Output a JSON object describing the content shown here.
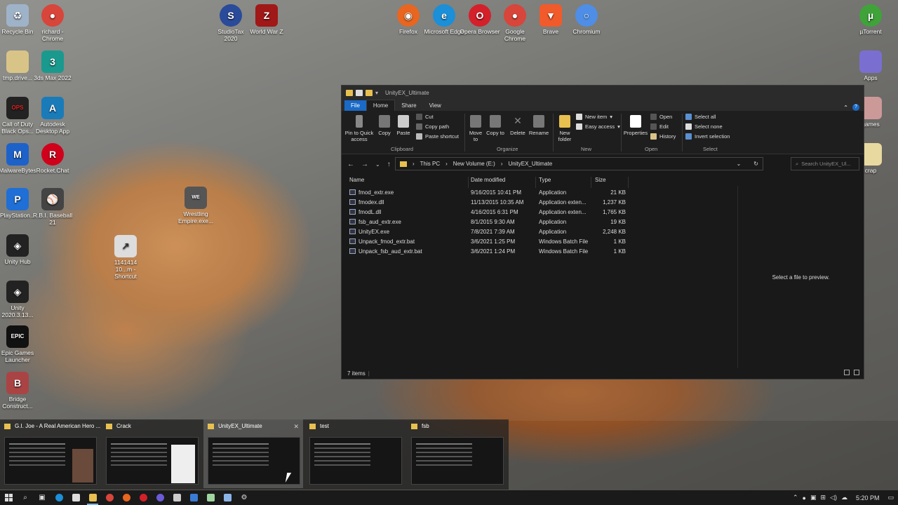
{
  "desktop": {
    "icons": [
      {
        "label": "Recycle Bin",
        "icon": "recycle-bin-icon",
        "color": "#9fb3c8"
      },
      {
        "label": "richard - Chrome",
        "icon": "chrome-icon",
        "color": "#d8453a"
      },
      {
        "label": "StudioTax 2020",
        "icon": "studiotax-icon",
        "color": "#2a4a9a"
      },
      {
        "label": "World War Z",
        "icon": "worldwarz-icon",
        "color": "#a01818"
      },
      {
        "label": "Firefox",
        "icon": "firefox-icon",
        "color": "#e8661f"
      },
      {
        "label": "Microsoft Edge",
        "icon": "edge-icon",
        "color": "#1b8fd8"
      },
      {
        "label": "Opera Browser",
        "icon": "opera-icon",
        "color": "#d4202a"
      },
      {
        "label": "Google Chrome",
        "icon": "chrome-icon",
        "color": "#d8453a"
      },
      {
        "label": "Brave",
        "icon": "brave-icon",
        "color": "#f15a2a"
      },
      {
        "label": "Chromium",
        "icon": "chromium-icon",
        "color": "#4e8ee6"
      },
      {
        "label": "µTorrent",
        "icon": "utorrent-icon",
        "color": "#3fa33a"
      },
      {
        "label": "tmp.drive...",
        "icon": "folder-icon",
        "color": "#d9c488"
      },
      {
        "label": "3ds Max 2022",
        "icon": "3dsmax-icon",
        "color": "#1a9a8e"
      },
      {
        "label": "Apps",
        "icon": "apps-folder-icon",
        "color": "#7a6fd0"
      },
      {
        "label": "Call of Duty Black Ops...",
        "icon": "cod-icon",
        "color": "#222"
      },
      {
        "label": "Autodesk Desktop App",
        "icon": "autodesk-icon",
        "color": "#1a7bb9"
      },
      {
        "label": "games",
        "icon": "games-folder-icon",
        "color": "#c99"
      },
      {
        "label": "MalwareBytes",
        "icon": "malwarebytes-icon",
        "color": "#1d62c9"
      },
      {
        "label": "Rocket.Chat",
        "icon": "rocketchat-icon",
        "color": "#d0021b"
      },
      {
        "label": "crap",
        "icon": "crap-folder-icon",
        "color": "#e8d9a0"
      },
      {
        "label": "Wrestling Empire.exe...",
        "icon": "wrestling-icon",
        "color": "#555"
      },
      {
        "label": "PlayStation...",
        "icon": "playstation-icon",
        "color": "#1f6fd6"
      },
      {
        "label": "R.B.I. Baseball 21",
        "icon": "rbi-icon",
        "color": "#444"
      },
      {
        "label": "1141414 10...m - Shortcut",
        "icon": "shortcut-icon",
        "color": "#ddd"
      },
      {
        "label": "Unity Hub",
        "icon": "unity-hub-icon",
        "color": "#222"
      },
      {
        "label": "Unity 2020.3.13...",
        "icon": "unity-icon",
        "color": "#222"
      },
      {
        "label": "Epic Games Launcher",
        "icon": "epic-icon",
        "color": "#111"
      },
      {
        "label": "Bridge Construct...",
        "icon": "bridge-icon",
        "color": "#a44"
      }
    ]
  },
  "explorer": {
    "title": "UnityEX_Ultimate",
    "tabs": [
      "File",
      "Home",
      "Share",
      "View"
    ],
    "ribbon": {
      "pin_quick_access": "Pin to Quick access",
      "copy": "Copy",
      "paste": "Paste",
      "cut": "Cut",
      "copy_path": "Copy path",
      "paste_shortcut": "Paste shortcut",
      "move_to": "Move to",
      "copy_to": "Copy to",
      "delete": "Delete",
      "rename": "Rename",
      "new_folder": "New folder",
      "new_item": "New item",
      "easy_access": "Easy access",
      "properties": "Properties",
      "open": "Open",
      "edit": "Edit",
      "history": "History",
      "select_all": "Select all",
      "select_none": "Select none",
      "invert_selection": "Invert selection",
      "groups": {
        "clipboard": "Clipboard",
        "organize": "Organize",
        "new": "New",
        "open": "Open",
        "select": "Select"
      }
    },
    "breadcrumb": [
      "This PC",
      "New Volume (E:)",
      "UnityEX_Ultimate"
    ],
    "search_placeholder": "Search UnityEX_Ul...",
    "columns": {
      "name": "Name",
      "date": "Date modified",
      "type": "Type",
      "size": "Size"
    },
    "files": [
      {
        "name": "fmod_extr.exe",
        "date": "9/16/2015 10:41 PM",
        "type": "Application",
        "size": "21 KB"
      },
      {
        "name": "fmodex.dll",
        "date": "11/13/2015 10:35 AM",
        "type": "Application exten...",
        "size": "1,237 KB"
      },
      {
        "name": "fmodL.dll",
        "date": "4/16/2015 6:31 PM",
        "type": "Application exten...",
        "size": "1,765 KB"
      },
      {
        "name": "fsb_aud_extr.exe",
        "date": "8/1/2015 9:30 AM",
        "type": "Application",
        "size": "19 KB"
      },
      {
        "name": "UnityEX.exe",
        "date": "7/8/2021 7:39 AM",
        "type": "Application",
        "size": "2,248 KB"
      },
      {
        "name": "Unpack_fmod_extr.bat",
        "date": "3/6/2021 1:25 PM",
        "type": "Windows Batch File",
        "size": "1 KB"
      },
      {
        "name": "Unpack_fsb_aud_extr.bat",
        "date": "3/6/2021 1:24 PM",
        "type": "Windows Batch File",
        "size": "1 KB"
      }
    ],
    "preview_text": "Select a file to preview.",
    "status": "7 items"
  },
  "task_switcher": [
    {
      "title": "G.I. Joe - A Real American Hero ...",
      "selected": false
    },
    {
      "title": "Crack",
      "selected": false
    },
    {
      "title": "UnityEX_Ultimate",
      "selected": true
    },
    {
      "title": "test",
      "selected": false
    },
    {
      "title": "fsb",
      "selected": false
    }
  ],
  "taskbar": {
    "clock": "5:20 PM"
  }
}
